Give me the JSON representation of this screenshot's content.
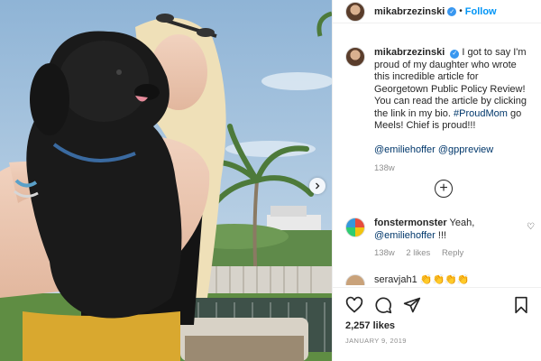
{
  "header": {
    "username": "mikabrzezinski",
    "verified_mark": "✓",
    "separator": "•",
    "follow_label": "Follow"
  },
  "caption": {
    "username": "mikabrzezinski",
    "text": "I got to say I'm proud of my daughter who wrote this incredible article for Georgetown Public Policy Review! You can read the article by clicking the link in my bio.",
    "hashtag": "#ProudMom",
    "text2": "go Meels! Chief is proud!!!",
    "mention1": "@emiliehoffer",
    "mention2": "@gppreview",
    "age": "138w"
  },
  "expand_symbol": "+",
  "comments": [
    {
      "username": "fonstermonster",
      "text": "Yeah,",
      "mention": "@emiliehoffer",
      "suffix": "!!!",
      "age": "138w",
      "likes": "2 likes",
      "reply": "Reply"
    },
    {
      "username": "seravjah1",
      "text": "👏👏👏👏"
    }
  ],
  "actions": {
    "likes": "2,257 likes",
    "date": "JANUARY 9, 2019"
  },
  "icons": {
    "like": "heart-icon",
    "comment": "comment-icon",
    "share": "paper-plane-icon",
    "save": "bookmark-icon",
    "next": "chevron-right-icon",
    "expand": "plus-circle-icon"
  },
  "colors": {
    "follow_blue": "#0095f6",
    "verified_blue": "#3897f0",
    "link_blue": "#00376b",
    "meta_gray": "#8e8e8e"
  }
}
